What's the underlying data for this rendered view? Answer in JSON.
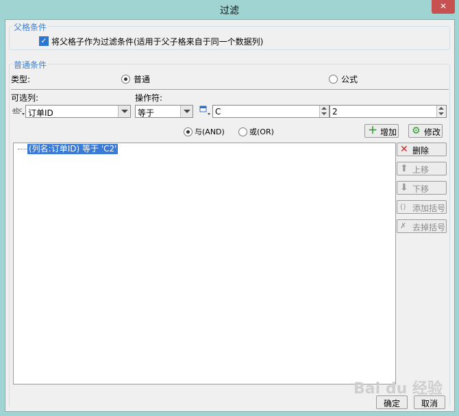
{
  "window": {
    "title": "过滤"
  },
  "parent_condition": {
    "legend": "父格条件",
    "checkbox_label": "将父格子作为过滤条件(适用于父子格来自于同一个数据列)",
    "checked": true
  },
  "normal_condition": {
    "legend": "普通条件",
    "type_label": "类型:",
    "type_options": [
      {
        "label": "普通",
        "selected": true
      },
      {
        "label": "公式",
        "selected": false
      }
    ],
    "column_label": "可选列:",
    "operator_label": "操作符:",
    "column_value": "订单ID",
    "operator_value": "等于",
    "value_input": "C",
    "value_input2": "2",
    "logic_options": [
      {
        "label": "与(AND)",
        "selected": true
      },
      {
        "label": "或(OR)",
        "selected": false
      }
    ],
    "add_button": "增加",
    "modify_button": "修改"
  },
  "condition_tree": {
    "items": [
      "(列名:订单ID) 等于 'C2'"
    ]
  },
  "side_buttons": {
    "delete": "删除",
    "move_up": "上移",
    "move_down": "下移",
    "add_bracket": "添加括号",
    "remove_bracket": "去掉括号"
  },
  "footer": {
    "ok": "确定",
    "cancel": "取消"
  },
  "watermark": "Bai du 经验",
  "icons": {
    "close": "close-icon",
    "abc": "abc-column-icon",
    "value_type": "value-type-icon",
    "plus": "plus-icon",
    "edit": "edit-icon",
    "delete": "red-x-icon",
    "up": "arrow-up-icon",
    "down": "arrow-down-icon",
    "bracket_add": "bracket-add-icon",
    "bracket_remove": "bracket-remove-icon"
  },
  "colors": {
    "titlebar": "#9fd4d2",
    "legend": "#3c7fcf",
    "selection": "#3a7bd5",
    "close": "#c75050"
  }
}
